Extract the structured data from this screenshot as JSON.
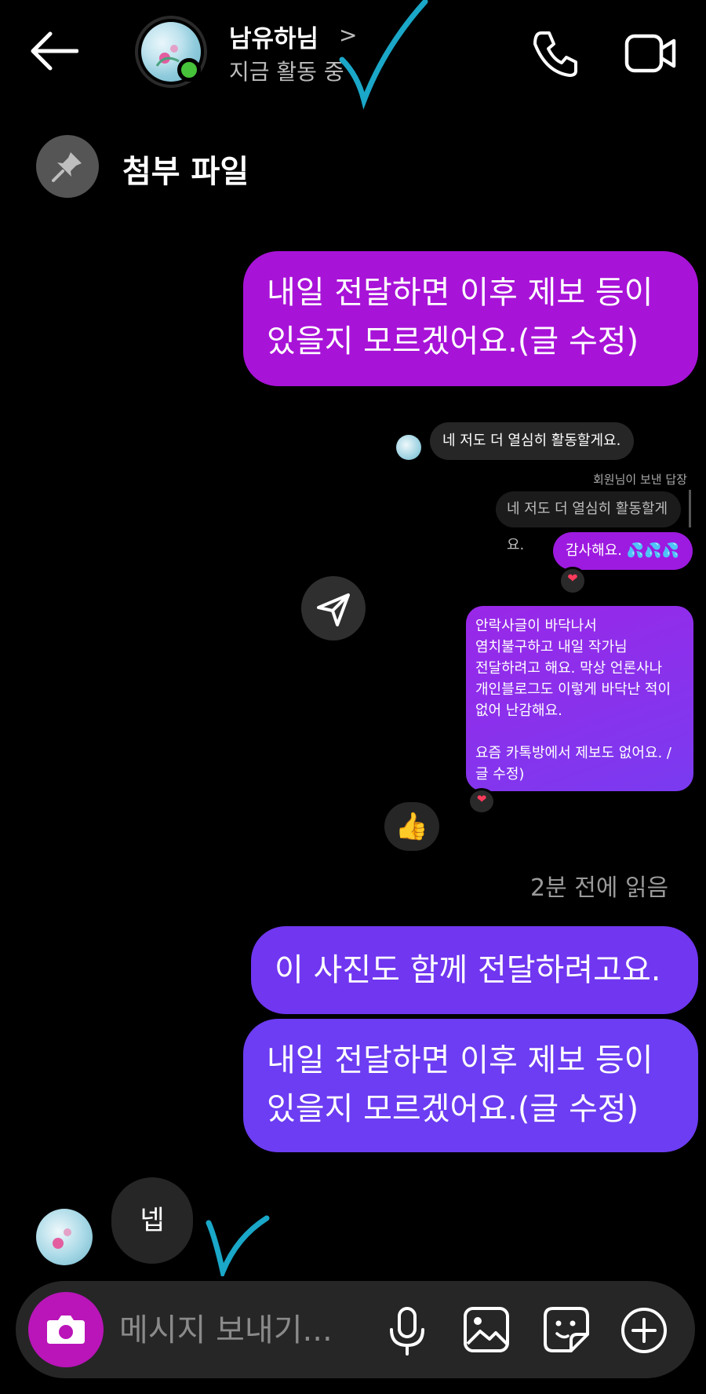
{
  "header": {
    "name": "남유하님",
    "chevron": ">",
    "status": "지금 활동 중"
  },
  "pinned": {
    "label": "첨부 파일"
  },
  "messages": {
    "m1": "내일 전달하면 이후 제보 등이 있을지 모르겠어요.(글 수정)",
    "m2": "네 저도 더 열심히 활동할게요.",
    "reply_label": "회원님이 보낸 답장",
    "m3": "네 저도 더 열심히 활동할게요.",
    "m4": "감사해요. 💦💦💦",
    "m5": "안락사글이 바닥나서\n염치불구하고 내일 작가님\n전달하려고 해요. 막상 언론사나\n개인블로그도 이렇게 바닥난 적이\n없어 난감해요.\n\n요즘 카톡방에서 제보도 없어요. /\n글 수정)",
    "thumb": "👍",
    "seen": "2분 전에 읽음",
    "m6": "이 사진도 함께 전달하려고요.",
    "m7": "내일 전달하면 이후 제보 등이 있을지 모르겠어요.(글 수정)",
    "m8": "넵"
  },
  "reactions": {
    "heart1": "❤",
    "heart2": "❤"
  },
  "composer": {
    "placeholder": "메시지 보내기..."
  },
  "colors": {
    "purple_bubble": "#a813d8",
    "violet_bubble": "#6c3df2",
    "camera_button": "#b915b8",
    "online_dot": "#46c33a",
    "annotation": "#1aa7c8"
  }
}
